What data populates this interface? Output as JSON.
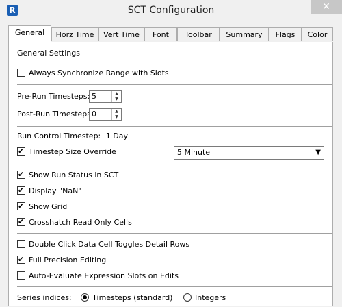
{
  "window": {
    "title": "SCT Configuration",
    "close_glyph": "✕"
  },
  "tabs": [
    "General",
    "Horz Time",
    "Vert Time",
    "Font",
    "Toolbar",
    "Summary",
    "Flags",
    "Color"
  ],
  "general": {
    "section_label": "General Settings",
    "always_sync": {
      "label": "Always Synchronize Range with Slots",
      "checked": false
    },
    "pre_run": {
      "label": "Pre-Run Timesteps:",
      "value": "5"
    },
    "post_run": {
      "label": "Post-Run Timesteps:",
      "value": "0"
    },
    "run_control": {
      "label": "Run Control Timestep:",
      "value": "1 Day"
    },
    "timestep_override": {
      "label": "Timestep Size Override",
      "checked": true,
      "selected": "5 Minute"
    },
    "show_run_status": {
      "label": "Show Run Status in SCT",
      "checked": true
    },
    "display_nan": {
      "label": "Display \"NaN\"",
      "checked": true
    },
    "show_grid": {
      "label": "Show Grid",
      "checked": true
    },
    "crosshatch": {
      "label": "Crosshatch Read Only Cells",
      "checked": true
    },
    "double_click": {
      "label": "Double Click Data Cell Toggles Detail Rows",
      "checked": false
    },
    "full_precision": {
      "label": "Full Precision Editing",
      "checked": true
    },
    "auto_evaluate": {
      "label": "Auto-Evaluate Expression Slots on Edits",
      "checked": false
    },
    "series_indices": {
      "label": "Series indices:",
      "options": [
        "Timesteps (standard)",
        "Integers"
      ],
      "selected": "Timesteps (standard)"
    }
  }
}
